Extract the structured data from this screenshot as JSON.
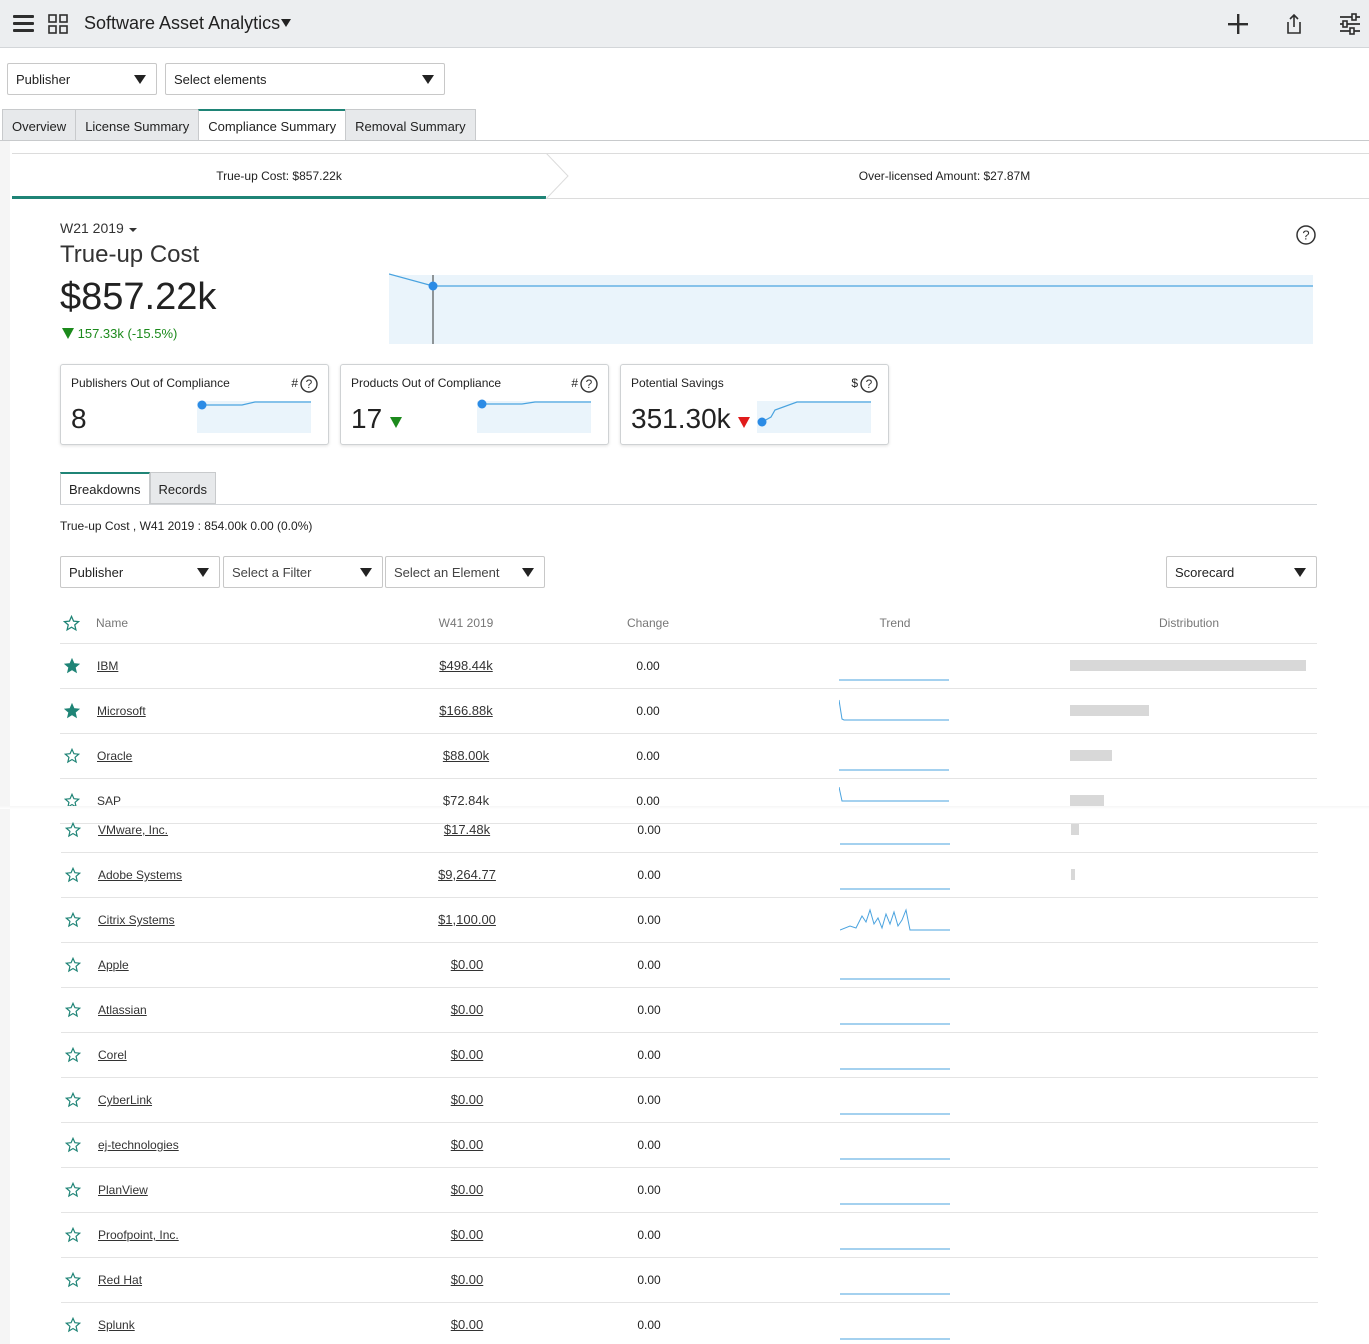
{
  "header": {
    "title": "Software Asset Analytics"
  },
  "filters": {
    "dimension": "Publisher",
    "elements_placeholder": "Select elements"
  },
  "tabs": [
    "Overview",
    "License Summary",
    "Compliance Summary",
    "Removal Summary"
  ],
  "active_tab": "Compliance Summary",
  "metric_strip": {
    "trueup": "True-up Cost: $857.22k",
    "overlicensed": "Over-licensed Amount: $27.87M"
  },
  "main_metric": {
    "period": "W21 2019",
    "title": "True-up Cost",
    "value": "$857.22k",
    "change": "157.33k (-15.5%)"
  },
  "cards": [
    {
      "title": "Publishers Out of Compliance",
      "unit": "#",
      "value": "8"
    },
    {
      "title": "Products Out of Compliance",
      "unit": "#",
      "value": "17"
    },
    {
      "title": "Potential Savings",
      "unit": "$",
      "value": "351.30k"
    }
  ],
  "subtabs": [
    "Breakdowns",
    "Records"
  ],
  "crumb": "True-up Cost , W41 2019 : 854.00k 0.00 (0.0%)",
  "breakdown_filters": {
    "group": "Publisher",
    "filter": "Select a Filter",
    "element": "Select an Element",
    "view": "Scorecard"
  },
  "table": {
    "headers": {
      "name": "Name",
      "value": "W41 2019",
      "change": "Change",
      "trend": "Trend",
      "distribution": "Distribution"
    },
    "rows": [
      {
        "name": "IBM",
        "value": "$498.44k",
        "change": "0.00",
        "starred": true,
        "dist": 1.0
      },
      {
        "name": "Microsoft",
        "value": "$166.88k",
        "change": "0.00",
        "starred": true,
        "dist": 0.335
      },
      {
        "name": "Oracle",
        "value": "$88.00k",
        "change": "0.00",
        "starred": false,
        "dist": 0.177
      },
      {
        "name": "SAP",
        "value": "$72.84k",
        "change": "0.00",
        "starred": false,
        "dist": 0.146
      },
      {
        "name": "VMware, Inc.",
        "value": "$17.48k",
        "change": "0.00",
        "starred": false,
        "dist": 0.035
      },
      {
        "name": "Adobe Systems",
        "value": "$9,264.77",
        "change": "0.00",
        "starred": false,
        "dist": 0.019
      },
      {
        "name": "Citrix Systems",
        "value": "$1,100.00",
        "change": "0.00",
        "starred": false,
        "dist": 0
      },
      {
        "name": "Apple",
        "value": "$0.00",
        "change": "0.00",
        "starred": false,
        "dist": 0
      },
      {
        "name": "Atlassian",
        "value": "$0.00",
        "change": "0.00",
        "starred": false,
        "dist": 0
      },
      {
        "name": "Corel",
        "value": "$0.00",
        "change": "0.00",
        "starred": false,
        "dist": 0
      },
      {
        "name": "CyberLink",
        "value": "$0.00",
        "change": "0.00",
        "starred": false,
        "dist": 0
      },
      {
        "name": "ej-technologies",
        "value": "$0.00",
        "change": "0.00",
        "starred": false,
        "dist": 0
      },
      {
        "name": "PlanView",
        "value": "$0.00",
        "change": "0.00",
        "starred": false,
        "dist": 0
      },
      {
        "name": "Proofpoint, Inc.",
        "value": "$0.00",
        "change": "0.00",
        "starred": false,
        "dist": 0
      },
      {
        "name": "Red Hat",
        "value": "$0.00",
        "change": "0.00",
        "starred": false,
        "dist": 0
      },
      {
        "name": "Splunk",
        "value": "$0.00",
        "change": "0.00",
        "starred": false,
        "dist": 0
      }
    ]
  },
  "colors": {
    "accent": "#1f8476",
    "positive": "#1c8a1c",
    "negative": "#e01b1b",
    "trend_line": "#4aa3df",
    "trend_fill": "#eaf4fb"
  }
}
